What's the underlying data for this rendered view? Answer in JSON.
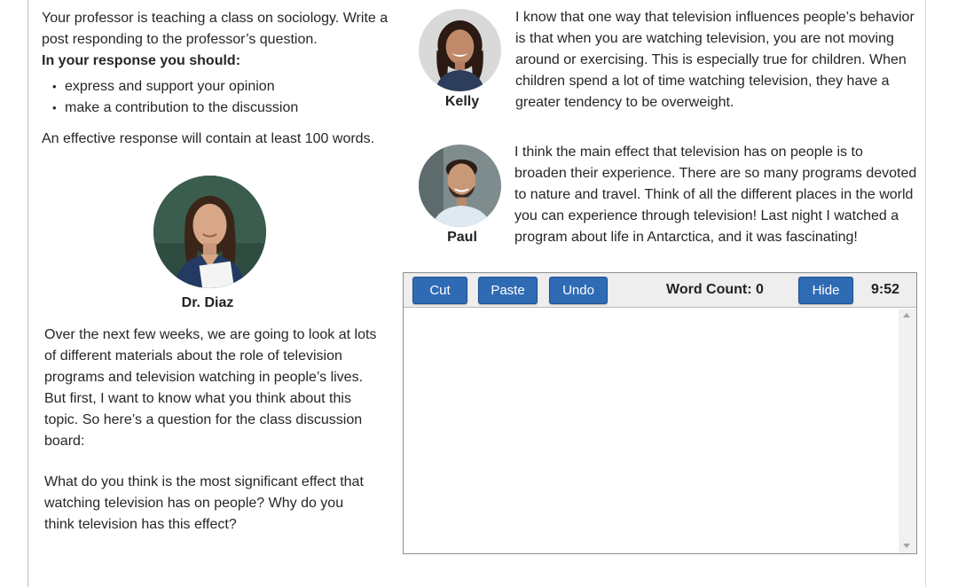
{
  "intro": {
    "line1": "Your professor is teaching a class on sociology. Write a post responding to the professor’s question.",
    "line2": "In your response you should:",
    "bullets": [
      "express and support your opinion",
      "make a contribution to the discussion"
    ],
    "effective": "An effective response will contain at least 100 words."
  },
  "professor": {
    "name": "Dr. Diaz",
    "text": "Over the next few weeks, we are going to look at lots of different materials about the role of television programs and television watching in people’s lives. But first, I want to know what you think about this topic. So here’s a question for the class discussion board:",
    "question": "What do you think is the most significant effect that watching television has on people? Why do you think television has this effect?"
  },
  "students": [
    {
      "name": "Kelly",
      "text": "I know that one way that television influences people’s behavior is that when you are watching television, you are not moving around or exercising. This is especially true for children. When children spend a lot of time watching television, they have a greater tendency to be overweight."
    },
    {
      "name": "Paul",
      "text": "I think the main effect that television has on people is to broaden their experience. There are so many programs devoted to nature and travel. Think of all the different places in the world you can experience through television! Last night I watched a program about life in Antarctica, and it was fascinating!"
    }
  ],
  "editor": {
    "cut": "Cut",
    "paste": "Paste",
    "undo": "Undo",
    "word_count_label": "Word Count: 0",
    "hide": "Hide",
    "timer": "9:52",
    "value": ""
  },
  "colors": {
    "button": "#2f6bb5",
    "toolbar": "#eeeeee"
  }
}
